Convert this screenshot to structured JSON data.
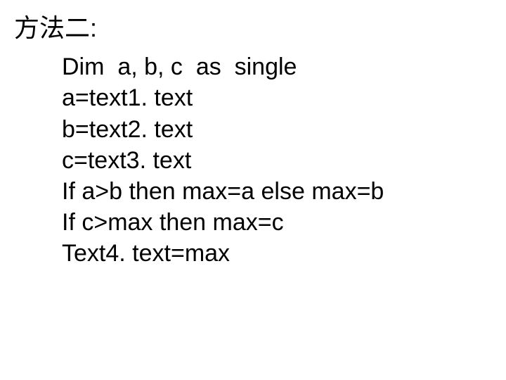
{
  "heading": "方法二:",
  "code": {
    "lines": [
      "Dim  a, b, c  as  single",
      "a=text1. text",
      "b=text2. text",
      "c=text3. text",
      "If a>b then max=a else max=b",
      "If c>max then max=c",
      "Text4. text=max"
    ]
  }
}
